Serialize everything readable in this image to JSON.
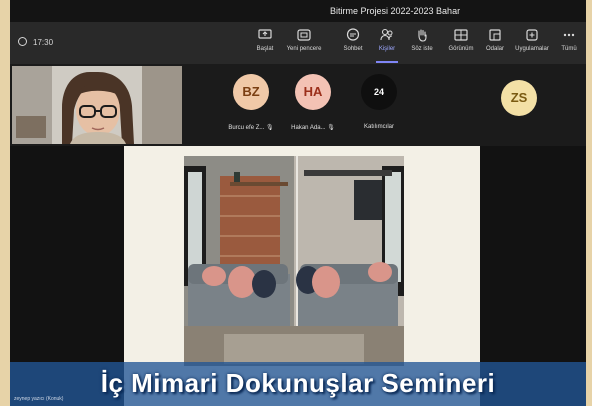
{
  "window": {
    "title": "Bitirme Projesi 2022-2023 Bahar"
  },
  "toolbar": {
    "timer": "17:30",
    "buttons": [
      {
        "label": "Başlat",
        "icon": "share-screen-icon"
      },
      {
        "label": "Yeni pencere",
        "icon": "new-window-icon"
      },
      {
        "label": "Sohbet",
        "icon": "chat-icon"
      },
      {
        "label": "Kişiler",
        "icon": "people-icon"
      },
      {
        "label": "Söz iste",
        "icon": "raise-hand-icon"
      },
      {
        "label": "Görünüm",
        "icon": "layout-icon"
      },
      {
        "label": "Odalar",
        "icon": "rooms-icon"
      },
      {
        "label": "Uygulamalar",
        "icon": "apps-icon"
      },
      {
        "label": "Tümü",
        "icon": "more-icon"
      }
    ]
  },
  "participants": [
    {
      "initials": "BZ",
      "name": "Burcu efe Z...",
      "color": "#f0c9a8",
      "text_color": "#7a3e12"
    },
    {
      "initials": "HA",
      "name": "Hakan Ada...",
      "color": "#f3c2b4",
      "text_color": "#9b2f1a"
    },
    {
      "initials": "24",
      "name": "Katılımcılar",
      "color": "#0f0f0f",
      "text_color": "#ffffff"
    },
    {
      "initials": "ZS",
      "name": "",
      "color": "#f3e0a6",
      "text_color": "#7a5a12"
    }
  ],
  "banner": {
    "text": "İç Mimari Dokunuşlar Semineri"
  },
  "presenter_caption": "zeynep yazıcı (Konuk)"
}
